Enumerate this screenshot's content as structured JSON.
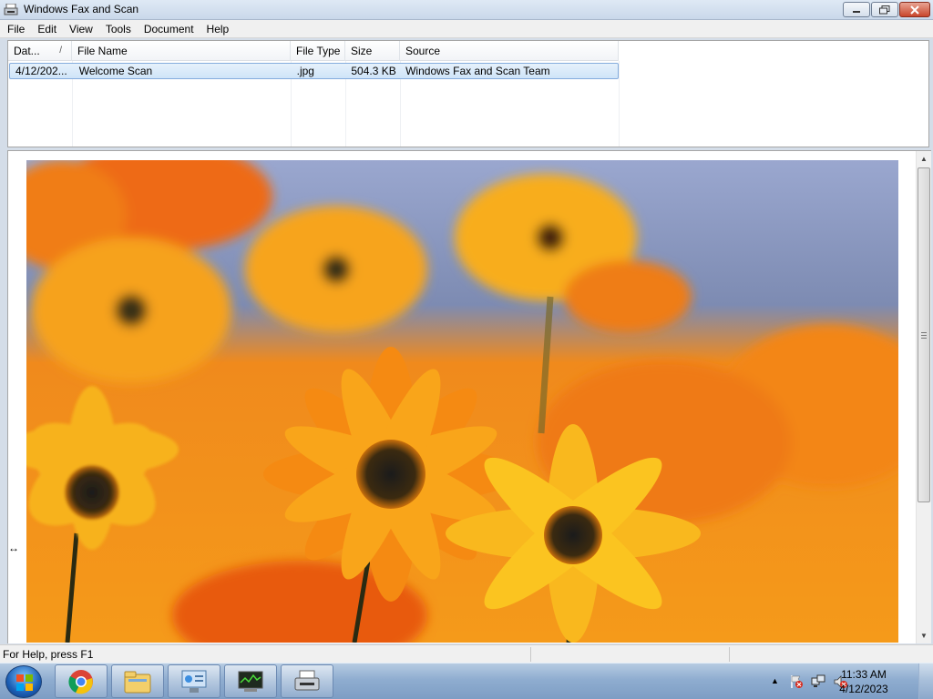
{
  "window": {
    "title": "Windows Fax and Scan"
  },
  "menu": [
    "File",
    "Edit",
    "View",
    "Tools",
    "Document",
    "Help"
  ],
  "list": {
    "columns": [
      "Dat...",
      "File Name",
      "File Type",
      "Size",
      "Source"
    ],
    "sort_indicator": "/",
    "rows": [
      {
        "date": "4/12/202...",
        "file_name": "Welcome Scan",
        "file_type": ".jpg",
        "size": "504.3 KB",
        "source": "Windows Fax and Scan Team"
      }
    ]
  },
  "status": {
    "help_text": "For Help, press F1"
  },
  "taskbar": {
    "items": [
      "windows-start-icon",
      "chrome-icon",
      "file-explorer-icon",
      "control-panel-icon",
      "system-monitor-icon",
      "fax-scan-icon"
    ],
    "clock_time": "11:33 AM",
    "clock_date": "4/12/2023"
  },
  "colors": {
    "accent": "#cfe4f8",
    "taskbar": "#8fadd0",
    "close": "#c9462c"
  }
}
